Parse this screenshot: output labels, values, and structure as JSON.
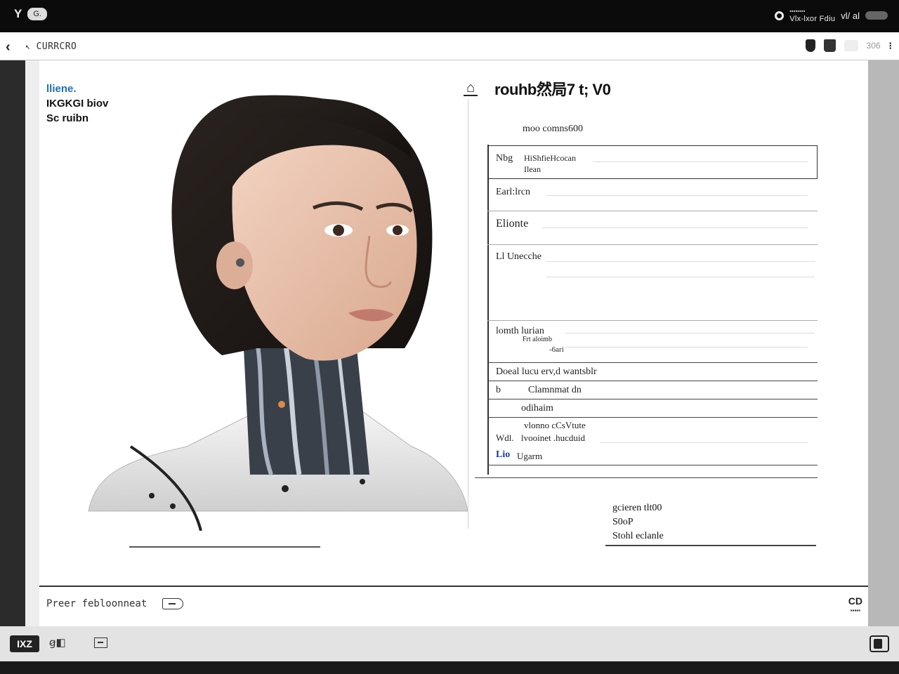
{
  "status_bar": {
    "left_label": "Y",
    "left_pill": "G.",
    "carrier_small": "▪▪▪▪▪▪▪▪",
    "carrier": "Vlx-lxor Fdiu",
    "signal": "vl/ al"
  },
  "browser": {
    "path": "CURRCRO",
    "right_number": "306"
  },
  "document": {
    "top_left": {
      "line1": "lliene.",
      "line2": "IKGKGI biov",
      "line3": "Sc ruibn"
    },
    "panel_title": "rouhb然局7 t; V0",
    "form": {
      "caption": "moo comns600",
      "name_label": "Nbg",
      "name_value_1": "HiShfieHcocan",
      "name_value_2": "Ilean",
      "row2_label": "Earl:lrcn",
      "row3_label": "Elionte",
      "row4_label": "Ll Unecche",
      "row5_label": "lomth lurian",
      "row5_sub1": "Frt aloimb",
      "row5_sub2": "-6ari",
      "row6_label": "Doeal lucu erv,d wantsblr",
      "row7_label": "b",
      "row7_value": "Clamnmat dn",
      "row8_value": "odihaim",
      "row9_value_top": "vlonno   cCsVtute",
      "row9_label": "Wdl.",
      "row9_value": "lvooinet  .hucduid",
      "row10_label": "Lio",
      "row10_value": "Ugarm"
    },
    "footer_block": {
      "line1": "gcieren tlt00",
      "line2": "S0oP",
      "line3": "Stohl  eclanle"
    },
    "footer": {
      "label": "Preer febloonneat",
      "right_top": "CD",
      "right_small": "▪▪▪▪▪"
    }
  },
  "toolbar": {
    "active_label": "IXZ",
    "dual_label": "ꞡ◧"
  },
  "colors": {
    "accent_blue": "#1e6fb5",
    "status_bar_bg": "#0b0b0b",
    "toolbar_bg": "#e3e3e3"
  }
}
